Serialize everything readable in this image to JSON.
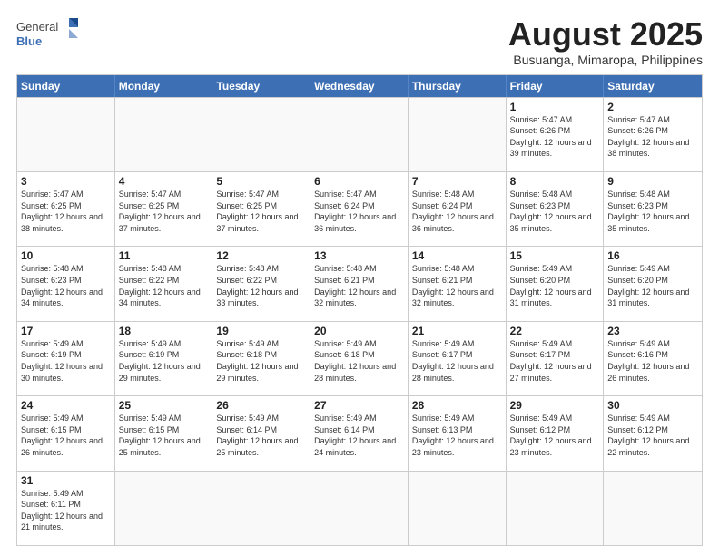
{
  "header": {
    "logo_general": "General",
    "logo_blue": "Blue",
    "month_title": "August 2025",
    "subtitle": "Busuanga, Mimaropa, Philippines"
  },
  "days_of_week": [
    "Sunday",
    "Monday",
    "Tuesday",
    "Wednesday",
    "Thursday",
    "Friday",
    "Saturday"
  ],
  "weeks": [
    [
      {
        "day": "",
        "info": ""
      },
      {
        "day": "",
        "info": ""
      },
      {
        "day": "",
        "info": ""
      },
      {
        "day": "",
        "info": ""
      },
      {
        "day": "",
        "info": ""
      },
      {
        "day": "1",
        "info": "Sunrise: 5:47 AM\nSunset: 6:26 PM\nDaylight: 12 hours\nand 39 minutes."
      },
      {
        "day": "2",
        "info": "Sunrise: 5:47 AM\nSunset: 6:26 PM\nDaylight: 12 hours\nand 38 minutes."
      }
    ],
    [
      {
        "day": "3",
        "info": "Sunrise: 5:47 AM\nSunset: 6:25 PM\nDaylight: 12 hours\nand 38 minutes."
      },
      {
        "day": "4",
        "info": "Sunrise: 5:47 AM\nSunset: 6:25 PM\nDaylight: 12 hours\nand 37 minutes."
      },
      {
        "day": "5",
        "info": "Sunrise: 5:47 AM\nSunset: 6:25 PM\nDaylight: 12 hours\nand 37 minutes."
      },
      {
        "day": "6",
        "info": "Sunrise: 5:47 AM\nSunset: 6:24 PM\nDaylight: 12 hours\nand 36 minutes."
      },
      {
        "day": "7",
        "info": "Sunrise: 5:48 AM\nSunset: 6:24 PM\nDaylight: 12 hours\nand 36 minutes."
      },
      {
        "day": "8",
        "info": "Sunrise: 5:48 AM\nSunset: 6:23 PM\nDaylight: 12 hours\nand 35 minutes."
      },
      {
        "day": "9",
        "info": "Sunrise: 5:48 AM\nSunset: 6:23 PM\nDaylight: 12 hours\nand 35 minutes."
      }
    ],
    [
      {
        "day": "10",
        "info": "Sunrise: 5:48 AM\nSunset: 6:23 PM\nDaylight: 12 hours\nand 34 minutes."
      },
      {
        "day": "11",
        "info": "Sunrise: 5:48 AM\nSunset: 6:22 PM\nDaylight: 12 hours\nand 34 minutes."
      },
      {
        "day": "12",
        "info": "Sunrise: 5:48 AM\nSunset: 6:22 PM\nDaylight: 12 hours\nand 33 minutes."
      },
      {
        "day": "13",
        "info": "Sunrise: 5:48 AM\nSunset: 6:21 PM\nDaylight: 12 hours\nand 32 minutes."
      },
      {
        "day": "14",
        "info": "Sunrise: 5:48 AM\nSunset: 6:21 PM\nDaylight: 12 hours\nand 32 minutes."
      },
      {
        "day": "15",
        "info": "Sunrise: 5:49 AM\nSunset: 6:20 PM\nDaylight: 12 hours\nand 31 minutes."
      },
      {
        "day": "16",
        "info": "Sunrise: 5:49 AM\nSunset: 6:20 PM\nDaylight: 12 hours\nand 31 minutes."
      }
    ],
    [
      {
        "day": "17",
        "info": "Sunrise: 5:49 AM\nSunset: 6:19 PM\nDaylight: 12 hours\nand 30 minutes."
      },
      {
        "day": "18",
        "info": "Sunrise: 5:49 AM\nSunset: 6:19 PM\nDaylight: 12 hours\nand 29 minutes."
      },
      {
        "day": "19",
        "info": "Sunrise: 5:49 AM\nSunset: 6:18 PM\nDaylight: 12 hours\nand 29 minutes."
      },
      {
        "day": "20",
        "info": "Sunrise: 5:49 AM\nSunset: 6:18 PM\nDaylight: 12 hours\nand 28 minutes."
      },
      {
        "day": "21",
        "info": "Sunrise: 5:49 AM\nSunset: 6:17 PM\nDaylight: 12 hours\nand 28 minutes."
      },
      {
        "day": "22",
        "info": "Sunrise: 5:49 AM\nSunset: 6:17 PM\nDaylight: 12 hours\nand 27 minutes."
      },
      {
        "day": "23",
        "info": "Sunrise: 5:49 AM\nSunset: 6:16 PM\nDaylight: 12 hours\nand 26 minutes."
      }
    ],
    [
      {
        "day": "24",
        "info": "Sunrise: 5:49 AM\nSunset: 6:15 PM\nDaylight: 12 hours\nand 26 minutes."
      },
      {
        "day": "25",
        "info": "Sunrise: 5:49 AM\nSunset: 6:15 PM\nDaylight: 12 hours\nand 25 minutes."
      },
      {
        "day": "26",
        "info": "Sunrise: 5:49 AM\nSunset: 6:14 PM\nDaylight: 12 hours\nand 25 minutes."
      },
      {
        "day": "27",
        "info": "Sunrise: 5:49 AM\nSunset: 6:14 PM\nDaylight: 12 hours\nand 24 minutes."
      },
      {
        "day": "28",
        "info": "Sunrise: 5:49 AM\nSunset: 6:13 PM\nDaylight: 12 hours\nand 23 minutes."
      },
      {
        "day": "29",
        "info": "Sunrise: 5:49 AM\nSunset: 6:12 PM\nDaylight: 12 hours\nand 23 minutes."
      },
      {
        "day": "30",
        "info": "Sunrise: 5:49 AM\nSunset: 6:12 PM\nDaylight: 12 hours\nand 22 minutes."
      }
    ],
    [
      {
        "day": "31",
        "info": "Sunrise: 5:49 AM\nSunset: 6:11 PM\nDaylight: 12 hours\nand 21 minutes."
      },
      {
        "day": "",
        "info": ""
      },
      {
        "day": "",
        "info": ""
      },
      {
        "day": "",
        "info": ""
      },
      {
        "day": "",
        "info": ""
      },
      {
        "day": "",
        "info": ""
      },
      {
        "day": "",
        "info": ""
      }
    ]
  ]
}
